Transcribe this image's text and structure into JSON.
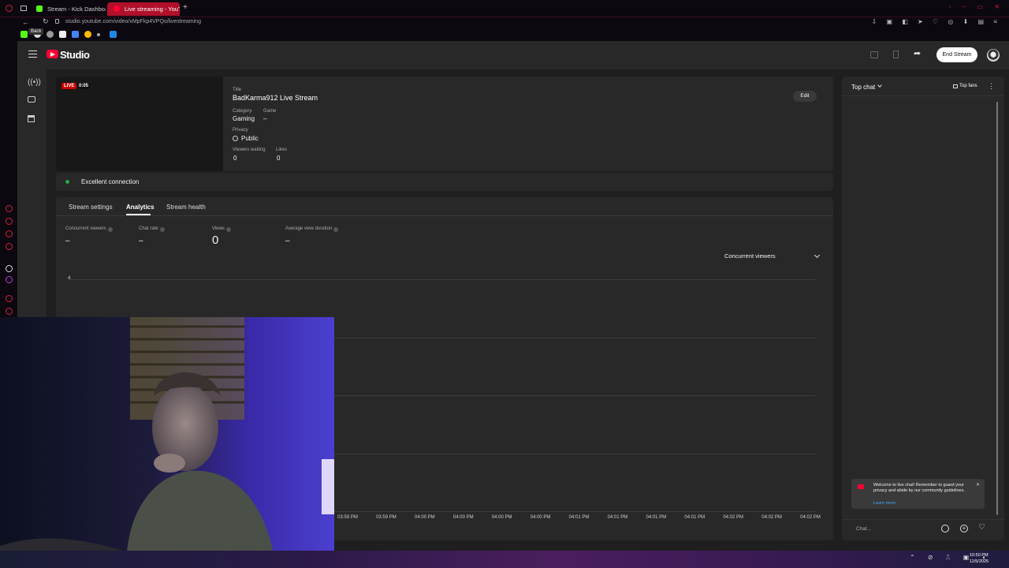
{
  "browser": {
    "tabs": [
      {
        "label": "Stream - Kick Dashboard",
        "active": false
      },
      {
        "label": "Live streaming - YouTube",
        "active": true
      }
    ],
    "url": "studio.youtube.com/video/xMpFkp4VPQo/livestreaming",
    "back_tooltip": "Back"
  },
  "studio": {
    "logo_text": "Studio",
    "end_stream_label": "End Stream"
  },
  "stream": {
    "live_badge": "LIVE",
    "elapsed": "0:05",
    "title_label": "Title",
    "title": "BadKarma912 Live Stream",
    "category_label": "Category",
    "category": "Gaming",
    "game_label": "Game",
    "game": "–",
    "privacy_label": "Privacy",
    "privacy": "Public",
    "viewers_waiting_label": "Viewers waiting",
    "viewers_waiting": "0",
    "likes_label": "Likes",
    "likes": "0",
    "edit_label": "Edit",
    "connection_status": "Excellent connection"
  },
  "tabs": [
    {
      "label": "Stream settings",
      "active": false
    },
    {
      "label": "Analytics",
      "active": true
    },
    {
      "label": "Stream health",
      "active": false
    }
  ],
  "metrics": [
    {
      "label": "Concurrent viewers",
      "value": "–"
    },
    {
      "label": "Chat rate",
      "value": "–"
    },
    {
      "label": "Views",
      "value": "0"
    },
    {
      "label": "Average view duration",
      "value": "–"
    }
  ],
  "chart_selector": "Concurrent viewers",
  "chart_data": {
    "type": "line",
    "title": "",
    "series": [],
    "x": [
      "03:59 PM",
      "03:59 PM",
      "04:00 PM",
      "04:00 PM",
      "04:00 PM",
      "04:00 PM",
      "04:01 PM",
      "04:01 PM",
      "04:01 PM",
      "04:01 PM",
      "04:02 PM",
      "04:02 PM",
      "04:02 PM"
    ],
    "y_ticks": [
      "4"
    ],
    "grid": true
  },
  "chat": {
    "header": "Top chat",
    "top_fans_label": "Top fans",
    "welcome_message": "Welcome to live chat! Remember to guard your privacy and abide by our community guidelines.",
    "learn_more": "Learn more",
    "input_placeholder": "Chat..."
  },
  "taskbar": {
    "time": "10:50 PM",
    "date": "11/5/2025"
  },
  "colors": {
    "live_red": "#cc0000",
    "status_green": "#2ba640",
    "accent_tab": "#ff0033"
  }
}
